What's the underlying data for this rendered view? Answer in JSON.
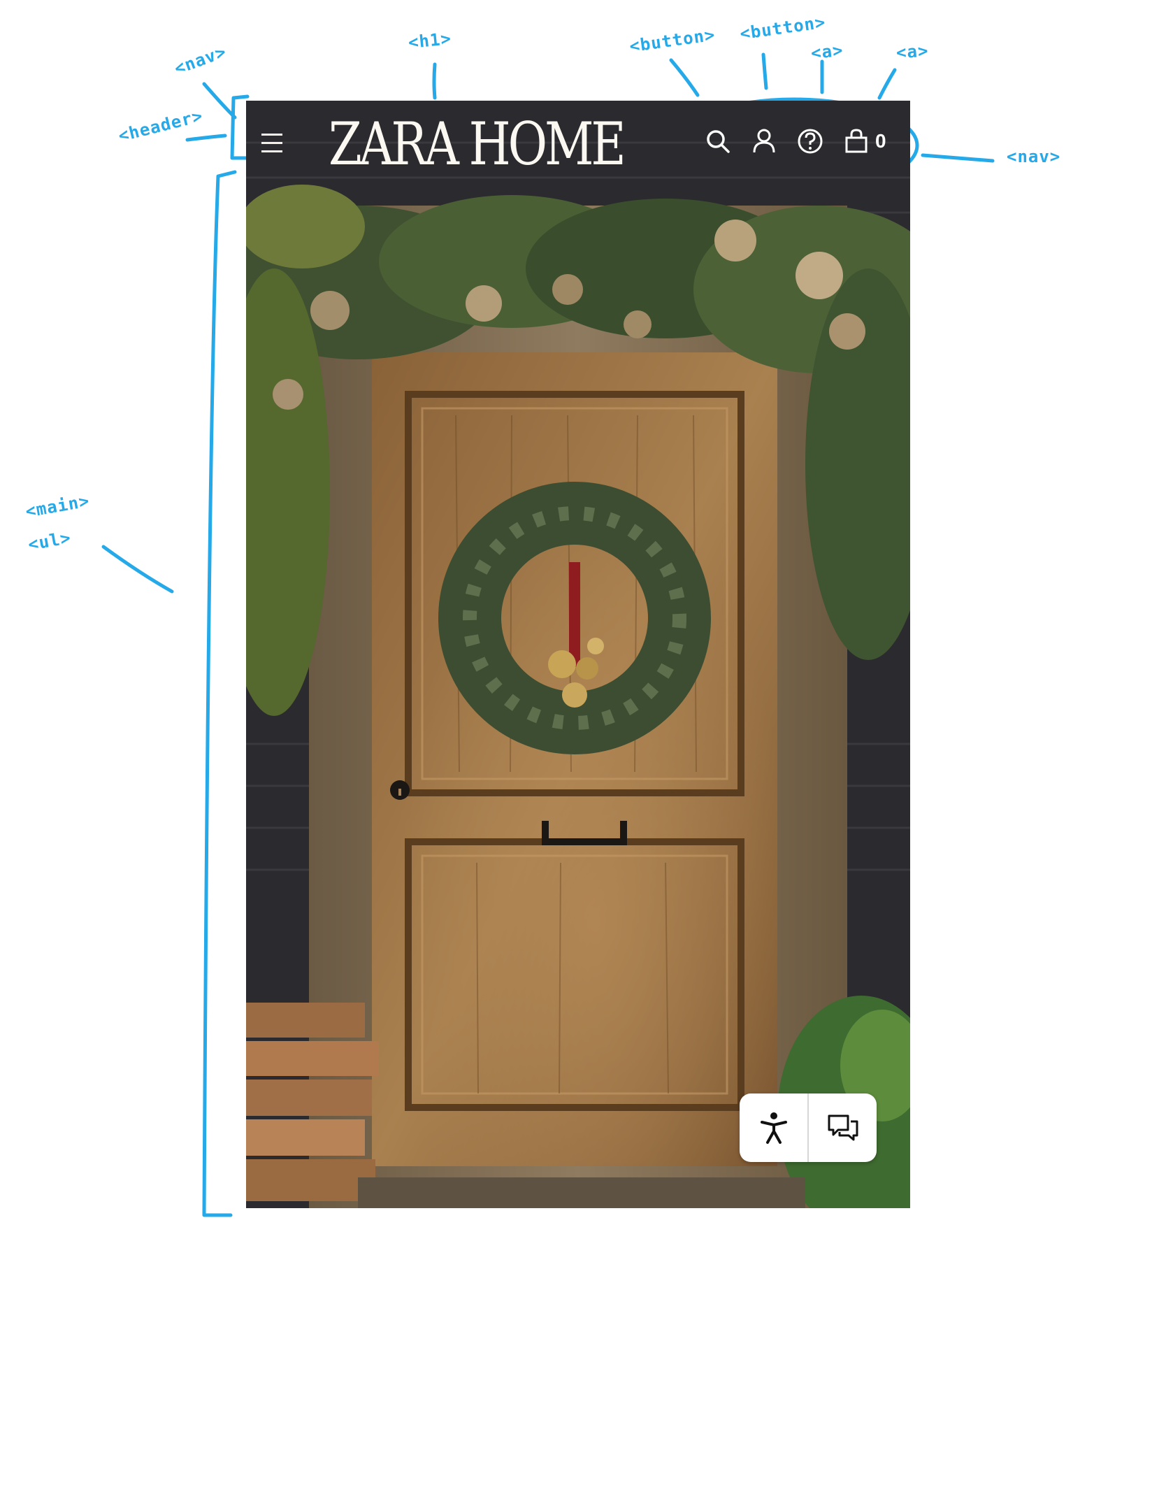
{
  "annotations": {
    "nav_menu": "<nav>",
    "h1": "<h1>",
    "button_search": "<button>",
    "button_account": "<button>",
    "a_help": "<a>",
    "a_bag": "<a>",
    "header": "<header>",
    "nav_icons": "<nav>",
    "main": "<main>",
    "ul": "<ul>"
  },
  "header": {
    "logo": "ZARA HOME",
    "cart_count": "0"
  },
  "icons": {
    "menu": "hamburger-menu-icon",
    "search": "search-icon",
    "account": "user-icon",
    "help": "help-circle-icon",
    "bag": "shopping-bag-icon",
    "accessibility": "accessibility-icon",
    "chat": "chat-bubbles-icon"
  },
  "hero": {
    "image": "wooden door decorated with evergreen garland and christmas wreath"
  },
  "colors": {
    "annotation": "#25a9e8",
    "header_text": "#ffffff",
    "widget_bg": "#ffffff"
  }
}
